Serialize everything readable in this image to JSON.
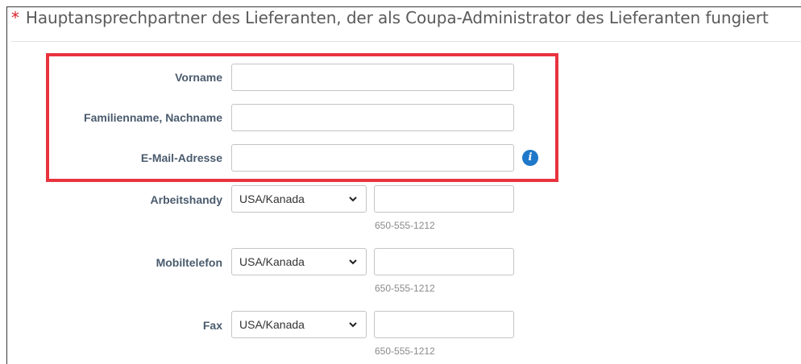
{
  "section": {
    "required_marker": "*",
    "title": "Hauptansprechpartner des Lieferanten, der als Coupa-Administrator des Lieferanten fungiert"
  },
  "fields": {
    "first_name": {
      "label": "Vorname",
      "value": ""
    },
    "last_name": {
      "label": "Familienname, Nachname",
      "value": ""
    },
    "email": {
      "label": "E-Mail-Adresse",
      "value": "",
      "info_icon": "info-icon"
    }
  },
  "phones": [
    {
      "label": "Arbeitshandy",
      "country": "USA/Kanada",
      "value": "",
      "hint": "650-555-1212"
    },
    {
      "label": "Mobiltelefon",
      "country": "USA/Kanada",
      "value": "",
      "hint": "650-555-1212"
    },
    {
      "label": "Fax",
      "country": "USA/Kanada",
      "value": "",
      "hint": "650-555-1212"
    }
  ],
  "colors": {
    "highlight_border": "#e8333f",
    "label_text": "#4a5b6e",
    "info_icon": "#1f78c9",
    "required": "#d8232a"
  }
}
